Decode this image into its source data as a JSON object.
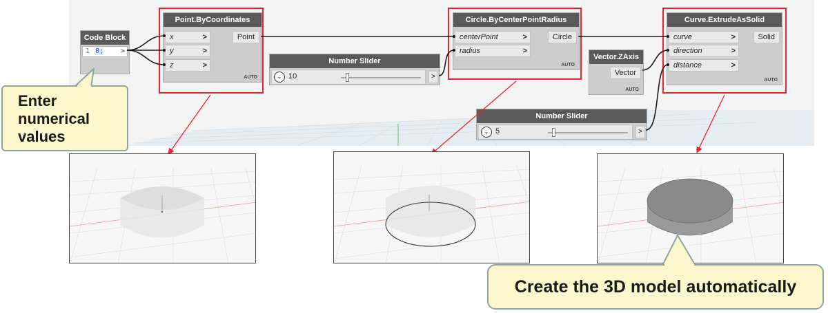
{
  "nodes": {
    "code_block": {
      "title": "Code Block",
      "line_no": "1",
      "code": "0;",
      "out": ">"
    },
    "point": {
      "title": "Point.ByCoordinates",
      "inputs": [
        "x",
        "y",
        "z"
      ],
      "output": "Point",
      "lacing": "AUTO"
    },
    "circle": {
      "title": "Circle.ByCenterPointRadius",
      "inputs": [
        "centerPoint",
        "radius"
      ],
      "output": "Circle",
      "lacing": "AUTO"
    },
    "vector": {
      "title": "Vector.ZAxis",
      "output": "Vector",
      "lacing": "AUTO"
    },
    "extrude": {
      "title": "Curve.ExtrudeAsSolid",
      "inputs": [
        "curve",
        "direction",
        "distance"
      ],
      "output": "Solid",
      "lacing": "AUTO"
    },
    "slider_radius": {
      "title": "Number Slider",
      "value": "10",
      "out": ">",
      "level": 0.06
    },
    "slider_distance": {
      "title": "Number Slider",
      "value": "5",
      "out": ">",
      "level": 0.05
    }
  },
  "port_arrow": ">",
  "slider_chevron": "⌄",
  "callouts": {
    "left": [
      "Enter",
      "numerical",
      "values"
    ],
    "bottom": "Create the 3D model automatically"
  },
  "colors": {
    "highlight": "#e8232b",
    "node_title": "#5a5a5a",
    "callout_fill": "#fcf6cc",
    "callout_border": "#8fa59b",
    "solid_gray": "#8c8c8c"
  }
}
